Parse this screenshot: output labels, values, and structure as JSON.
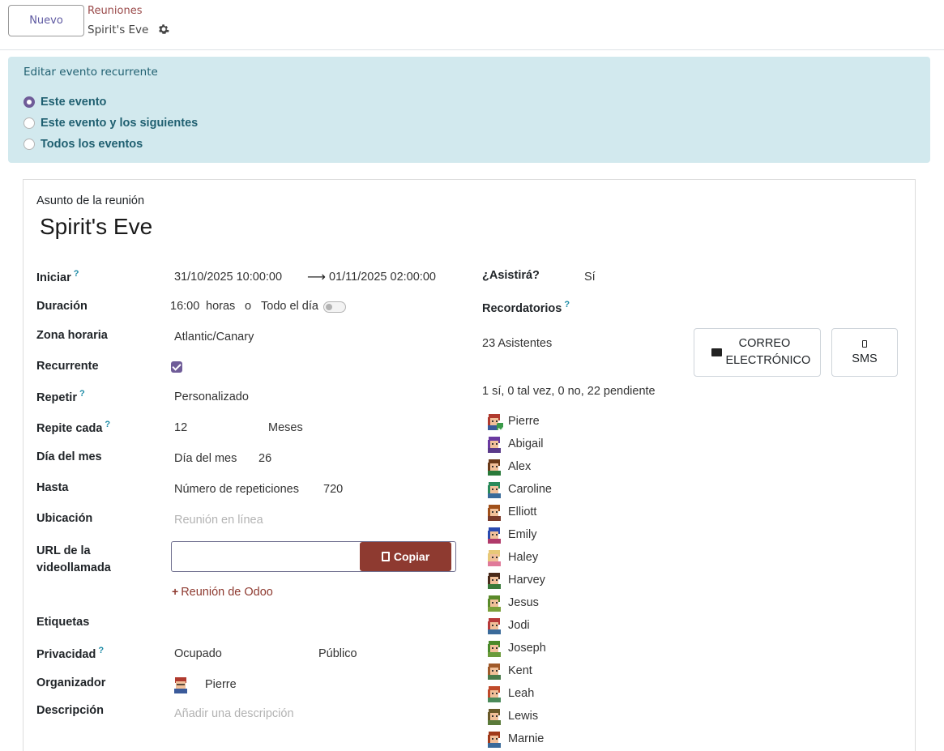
{
  "control_panel": {
    "new_button": "Nuevo",
    "breadcrumb_parent": "Reuniones",
    "breadcrumb_current": "Spirit's Eve",
    "gear_icon": "gear-icon"
  },
  "recurrence_alert": {
    "title": "Editar evento recurrente",
    "options": [
      {
        "label": "Este evento",
        "selected": true
      },
      {
        "label": "Este evento y los siguientes",
        "selected": false
      },
      {
        "label": "Todos los eventos",
        "selected": false
      }
    ]
  },
  "form": {
    "subject_label": "Asunto de la reunión",
    "subject_value": "Spirit's Eve",
    "start_label": "Iniciar",
    "start_value": "31/10/2025 10:00:00",
    "end_value": "01/11/2025 02:00:00",
    "duration_label": "Duración",
    "duration_value": "16:00",
    "duration_unit": "horas",
    "duration_or": "o",
    "allday_label": "Todo el día",
    "timezone_label": "Zona horaria",
    "timezone_value": "Atlantic/Canary",
    "recurrent_label": "Recurrente",
    "repeat_label": "Repetir",
    "repeat_value": "Personalizado",
    "repeat_every_label": "Repite cada",
    "repeat_every_value": "12",
    "repeat_every_unit": "Meses",
    "day_of_month_label": "Día del mes",
    "day_of_month_mode": "Día del mes",
    "day_of_month_value": "26",
    "until_label": "Hasta",
    "until_mode": "Número de repeticiones",
    "until_value": "720",
    "location_label": "Ubicación",
    "location_placeholder": "Reunión en línea",
    "video_url_label": "URL de la videollamada",
    "copy_button": "Copiar",
    "odoo_meeting_link": "Reunión de Odoo",
    "tags_label": "Etiquetas",
    "privacy_label": "Privacidad",
    "privacy_show_as": "Ocupado",
    "privacy_value": "Público",
    "organizer_label": "Organizador",
    "organizer_name": "Pierre",
    "description_label": "Descripción",
    "description_placeholder": "Añadir una descripción",
    "attend_label": "¿Asistirá?",
    "attend_value": "Sí",
    "reminders_label": "Recordatorios",
    "attendees_count": "23 Asistentes",
    "email_button": "CORREO ELECTRÓNICO",
    "sms_button": "SMS",
    "attendees_summary": "1 sí, 0 tal vez, 0 no, 22 pendiente",
    "attendees": [
      {
        "name": "Pierre",
        "hair": "#b03a2e",
        "shirt": "#3a5a9a",
        "accepted": true
      },
      {
        "name": "Abigail",
        "hair": "#6a3aa0",
        "shirt": "#5a3a8a",
        "accepted": false
      },
      {
        "name": "Alex",
        "hair": "#6a3a1a",
        "shirt": "#2a7a3a",
        "accepted": false
      },
      {
        "name": "Caroline",
        "hair": "#2a8a5a",
        "shirt": "#3a6a9a",
        "accepted": false
      },
      {
        "name": "Elliott",
        "hair": "#a0501a",
        "shirt": "#7a3a2a",
        "accepted": false
      },
      {
        "name": "Emily",
        "hair": "#2a4ab0",
        "shirt": "#b03a6a",
        "accepted": false
      },
      {
        "name": "Haley",
        "hair": "#e8c878",
        "shirt": "#e07a9a",
        "accepted": false
      },
      {
        "name": "Harvey",
        "hair": "#4a2a1a",
        "shirt": "#3a7a3a",
        "accepted": false
      },
      {
        "name": "Jesus",
        "hair": "#5a8a2a",
        "shirt": "#7aa03a",
        "accepted": false
      },
      {
        "name": "Jodi",
        "hair": "#b83a3a",
        "shirt": "#3a6a9a",
        "accepted": false
      },
      {
        "name": "Joseph",
        "hair": "#4a8a2a",
        "shirt": "#6a9a3a",
        "accepted": false
      },
      {
        "name": "Kent",
        "hair": "#a05a2a",
        "shirt": "#4a7a4a",
        "accepted": false
      },
      {
        "name": "Leah",
        "hair": "#c04a2a",
        "shirt": "#4a8a5a",
        "accepted": false
      },
      {
        "name": "Lewis",
        "hair": "#6a5a2a",
        "shirt": "#5a7a3a",
        "accepted": false
      },
      {
        "name": "Marnie",
        "hair": "#a03a1a",
        "shirt": "#3a6a9a",
        "accepted": false
      }
    ]
  },
  "colors": {
    "brand": "#6f5c98",
    "alert_bg": "#d2e9ee",
    "alert_text": "#1f5f70",
    "copy_button": "#8e3a30",
    "help_mark": "#1d8ba6"
  }
}
